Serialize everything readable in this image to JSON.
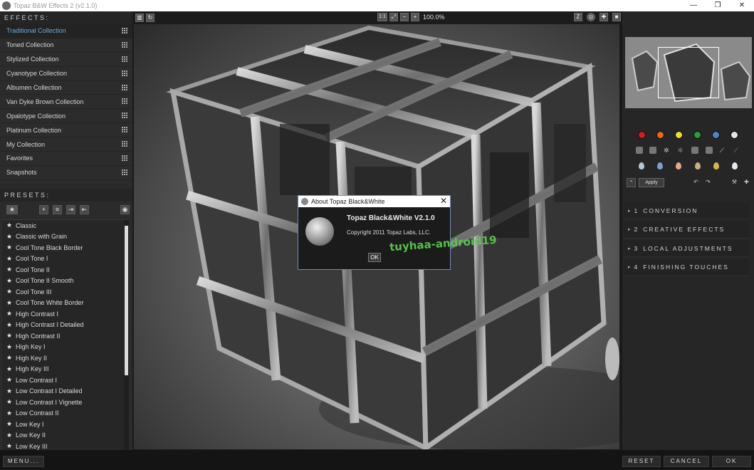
{
  "window": {
    "title": "Topaz B&W Effects 2 (v2.1.0)",
    "controls": [
      "—",
      "❐",
      "✕"
    ]
  },
  "effects": {
    "header": "EFFECTS:",
    "items": [
      {
        "label": "Traditional Collection",
        "active": true
      },
      {
        "label": "Toned Collection"
      },
      {
        "label": "Stylized Collection"
      },
      {
        "label": "Cyanotype Collection"
      },
      {
        "label": "Albumen Collection"
      },
      {
        "label": "Van Dyke Brown Collection"
      },
      {
        "label": "Opalotype Collection"
      },
      {
        "label": "Platinum Collection"
      },
      {
        "label": "My Collection"
      },
      {
        "label": "Favorites"
      },
      {
        "label": "Snapshots"
      }
    ]
  },
  "presets": {
    "header": "PRESETS:",
    "items": [
      "Classic",
      "Classic with Grain",
      "Cool Tone Black Border",
      "Cool Tone I",
      "Cool Tone II",
      "Cool Tone II Smooth",
      "Cool Tone III",
      "Cool Tone White Border",
      "High Contrast I",
      "High Contrast I Detailed",
      "High Contrast II",
      "High Key I",
      "High Key II",
      "High Key III",
      "Low Contrast I",
      "Low Contrast I Detailed",
      "Low Contrast I Vignette",
      "Low Contrast II",
      "Low Key I",
      "Low Key II",
      "Low Key III"
    ]
  },
  "toolbar": {
    "zoom_fit": "1:1",
    "zoom_level": "100.0%"
  },
  "dialog": {
    "title": "About Topaz Black&White",
    "product": "Topaz Black&White V2.1.0",
    "copyright": "Copyright 2011 Topaz Labs, LLC.",
    "ok": "OK"
  },
  "watermark": "tuyhaa-android19",
  "right_panel": {
    "colors": [
      "#d61c1c",
      "#ee6a12",
      "#e8e22a",
      "#2e9a3a",
      "#4b86c8",
      "#e6e6e6"
    ],
    "apply_label": "Apply",
    "sections": [
      {
        "num": "1",
        "label": "CONVERSION"
      },
      {
        "num": "2",
        "label": "CREATIVE EFFECTS"
      },
      {
        "num": "3",
        "label": "LOCAL ADJUSTMENTS"
      },
      {
        "num": "4",
        "label": "FINISHING TOUCHES"
      }
    ]
  },
  "bottom": {
    "menu": "MENU...",
    "reset": "RESET",
    "cancel": "CANCEL",
    "ok": "OK"
  }
}
